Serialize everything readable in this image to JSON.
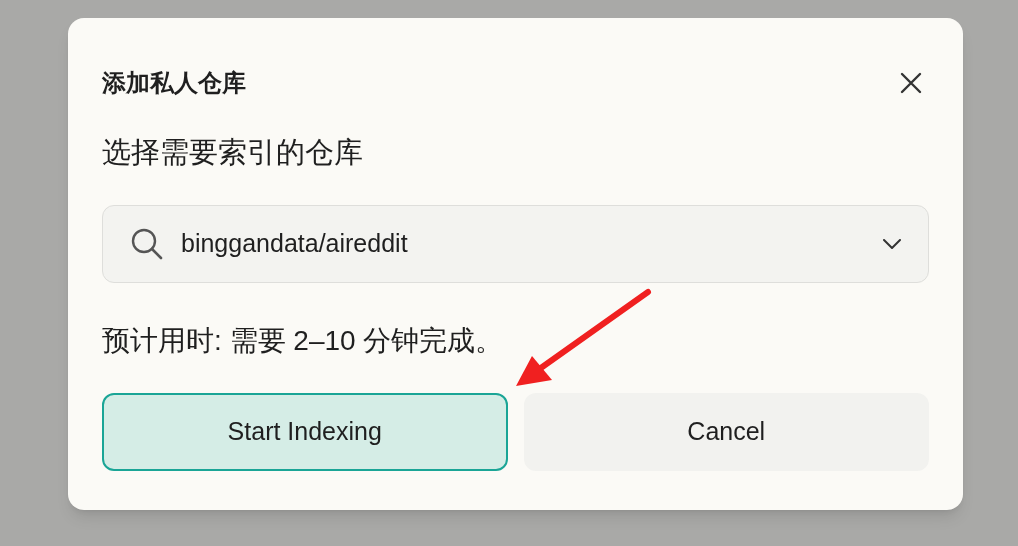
{
  "dialog": {
    "title": "添加私人仓库",
    "label": "选择需要索引的仓库",
    "select": {
      "value": "binggandata/aireddit"
    },
    "estimate": "预计用时: 需要 2–10 分钟完成。",
    "buttons": [
      {
        "label": "Start Indexing",
        "kind": "primary"
      },
      {
        "label": "Cancel",
        "kind": "secondary"
      }
    ]
  }
}
